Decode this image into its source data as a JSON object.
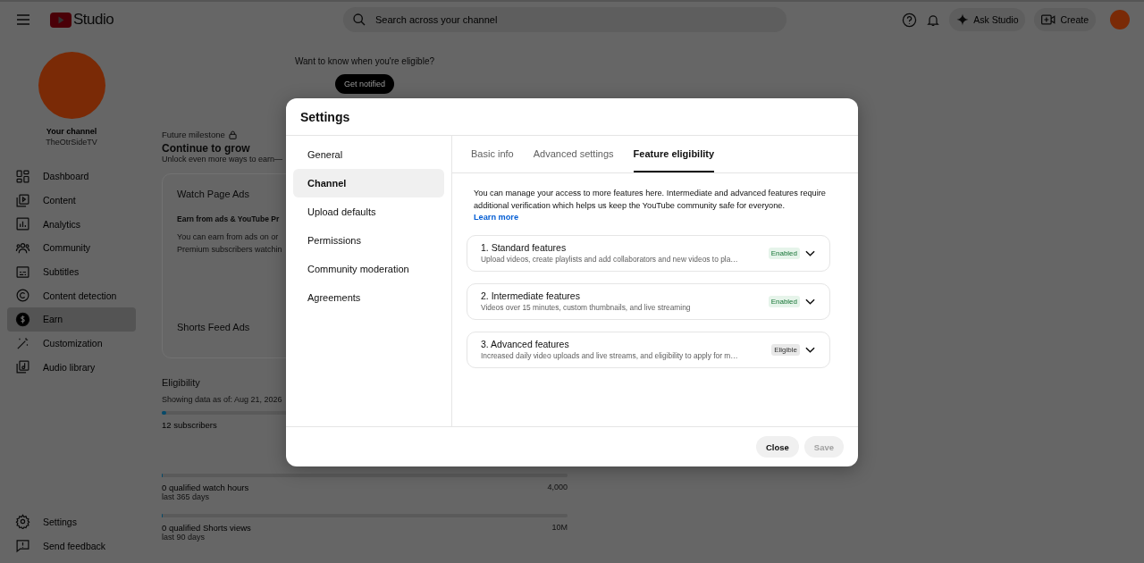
{
  "header": {
    "studio_label": "Studio",
    "search": {
      "placeholder": "Search across your channel"
    },
    "ask_button": "Ask Studio",
    "create_button": "Create"
  },
  "sidebar": {
    "channel_label": "Your channel",
    "channel_name": "TheOtrSideTV",
    "items": [
      {
        "label": "Dashboard",
        "selected": false
      },
      {
        "label": "Content",
        "selected": false
      },
      {
        "label": "Analytics",
        "selected": false
      },
      {
        "label": "Community",
        "selected": false
      },
      {
        "label": "Subtitles",
        "selected": false
      },
      {
        "label": "Content detection",
        "selected": false
      },
      {
        "label": "Earn",
        "selected": true
      },
      {
        "label": "Customization",
        "selected": false
      },
      {
        "label": "Audio library",
        "selected": false
      }
    ],
    "bottom_items": [
      {
        "label": "Settings"
      },
      {
        "label": "Send feedback"
      }
    ]
  },
  "main": {
    "notify_prompt": "Want to know when you're eligible?",
    "notify_button": "Get notified",
    "milestone_label": "Future milestone",
    "milestone_title": "Continue to grow",
    "milestone_text": "Unlock even more ways to earn—",
    "card": {
      "title": "Watch Page Ads",
      "subtitle": "Earn from ads & YouTube Pr",
      "text_lines": [
        "You can earn from ads on or",
        "Premium subscribers watchin"
      ],
      "footer_title": "Shorts Feed Ads"
    },
    "eligibility": {
      "title": "Eligibility",
      "date": "Showing data as of: Aug 21, 2026",
      "metrics": [
        {
          "label": "12 subscribers",
          "level": 0.01
        },
        {
          "label": "0 qualified watch hours",
          "period": "last 365 days",
          "target": "4,000",
          "level": 0
        },
        {
          "label": "0 qualified Shorts views",
          "period": "last 90 days",
          "target": "10M",
          "level": 0
        }
      ]
    }
  },
  "dialog": {
    "title": "Settings",
    "nav": [
      {
        "label": "General",
        "selected": false
      },
      {
        "label": "Channel",
        "selected": true
      },
      {
        "label": "Upload defaults",
        "selected": false
      },
      {
        "label": "Permissions",
        "selected": false
      },
      {
        "label": "Community moderation",
        "selected": false
      },
      {
        "label": "Agreements",
        "selected": false
      }
    ],
    "tabs": [
      {
        "label": "Basic info",
        "selected": false
      },
      {
        "label": "Advanced settings",
        "selected": false
      },
      {
        "label": "Feature eligibility",
        "selected": true
      }
    ],
    "intro": "You can manage your access to more features here. Intermediate and advanced features require additional verification which helps us keep the YouTube community safe for everyone.",
    "learn_more": "Learn more",
    "features": [
      {
        "title": "1. Standard features",
        "description": "Upload videos, create playlists and add collaborators and new videos to pla…",
        "badge": {
          "label": "Enabled",
          "kind": "enabled"
        },
        "expanded": false
      },
      {
        "title": "2. Intermediate features",
        "description": "Videos over 15 minutes, custom thumbnails, and live streaming",
        "badge": {
          "label": "Enabled",
          "kind": "enabled"
        },
        "expanded": false
      },
      {
        "title": "3. Advanced features",
        "description": "Increased daily video uploads and live streams, and eligibility to apply for m…",
        "badge": {
          "label": "Eligible",
          "kind": "eligible"
        },
        "expanded": false
      }
    ],
    "buttons": [
      {
        "label": "Close",
        "disabled": false
      },
      {
        "label": "Save",
        "disabled": true
      }
    ]
  }
}
